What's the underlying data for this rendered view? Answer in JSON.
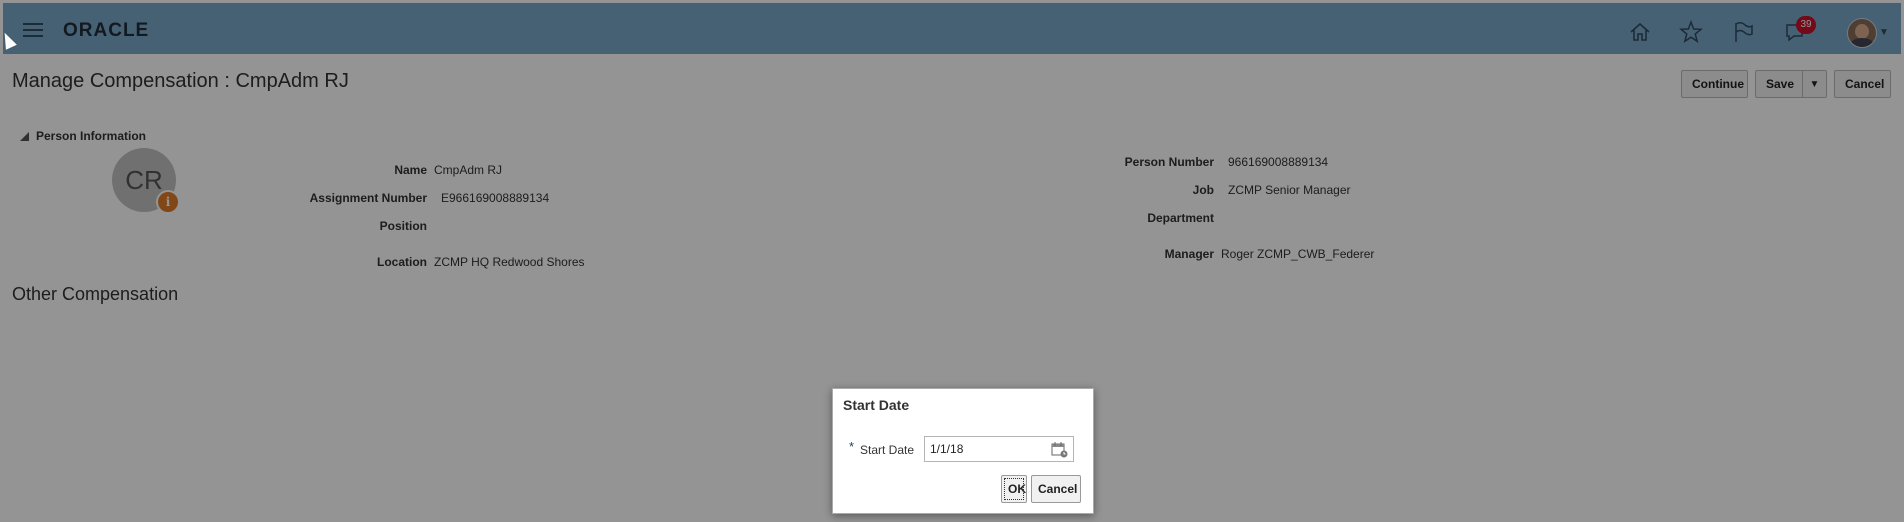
{
  "header": {
    "logo": "ORACLE",
    "notification_count": "39",
    "icons": [
      "home-icon",
      "favorites-star-icon",
      "watchlist-flag-icon",
      "notifications-icon"
    ]
  },
  "page": {
    "title": "Manage Compensation : CmpAdm RJ",
    "buttons": {
      "continue": "Continue",
      "save": "Save",
      "save_menu": "▼",
      "cancel": "Cancel"
    }
  },
  "person_info": {
    "section_label": "Person Information",
    "initials": "CR",
    "info_badge": "i",
    "left": [
      {
        "label": "Name",
        "value": "CmpAdm RJ"
      },
      {
        "label": "Assignment Number",
        "value": "E966169008889134"
      },
      {
        "label": "Position",
        "value": ""
      },
      {
        "label": "Location",
        "value": "ZCMP HQ Redwood Shores"
      }
    ],
    "right": [
      {
        "label": "Person Number",
        "value": "966169008889134"
      },
      {
        "label": "Job",
        "value": "ZCMP Senior Manager"
      },
      {
        "label": "Department",
        "value": ""
      },
      {
        "label": "Manager",
        "value": "Roger ZCMP_CWB_Federer"
      }
    ]
  },
  "other_compensation": {
    "title": "Other Compensation"
  },
  "dialog": {
    "title": "Start Date",
    "required_marker": "*",
    "field_label": "Start Date",
    "field_value": "1/1/18",
    "ok_label": "OK",
    "cancel_label": "Cancel"
  },
  "colors": {
    "header_bg": "#7aa7c8",
    "badge": "#c9102a",
    "info_badge": "#e07a26"
  }
}
